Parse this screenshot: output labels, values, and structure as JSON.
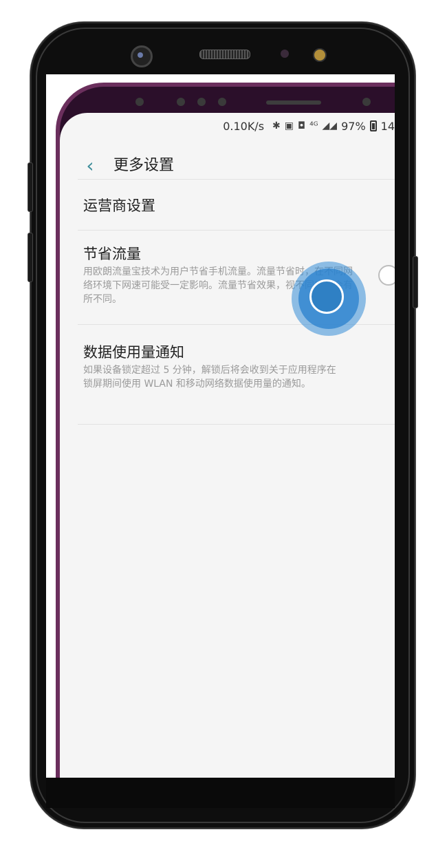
{
  "status_bar": {
    "network_speed": "0.10K/s",
    "bluetooth_icon": "bluetooth-icon",
    "nfc_icon": "nfc-icon",
    "signal_text": "⁴ᴳ",
    "signal_icons": "◢◢",
    "battery_percent": "97%",
    "clock_partial": "14"
  },
  "header": {
    "back_icon": "chevron-left-icon",
    "title": "更多设置"
  },
  "settings": {
    "carrier": {
      "title": "运营商设置"
    },
    "data_saver": {
      "title": "节省流量",
      "description": "用欧朗流量宝技术为用户节省手机流量。流量节省时，在不同网络环境下网速可能受一定影响。流量节省效果，视不同应用会有所不同。",
      "enabled": false
    },
    "data_usage_notify": {
      "title": "数据使用量通知",
      "description": "如果设备锁定超过 5 分钟，解锁后将会收到关于应用程序在锁屏期间使用 WLAN 和移动网络数据使用量的通知。",
      "enabled": false
    }
  },
  "colors": {
    "accent": "#3f8e9b",
    "touch_indicator": "#2f80c4",
    "phone_body": "#0e0e0e",
    "background_phone": "#6b2f5d"
  }
}
